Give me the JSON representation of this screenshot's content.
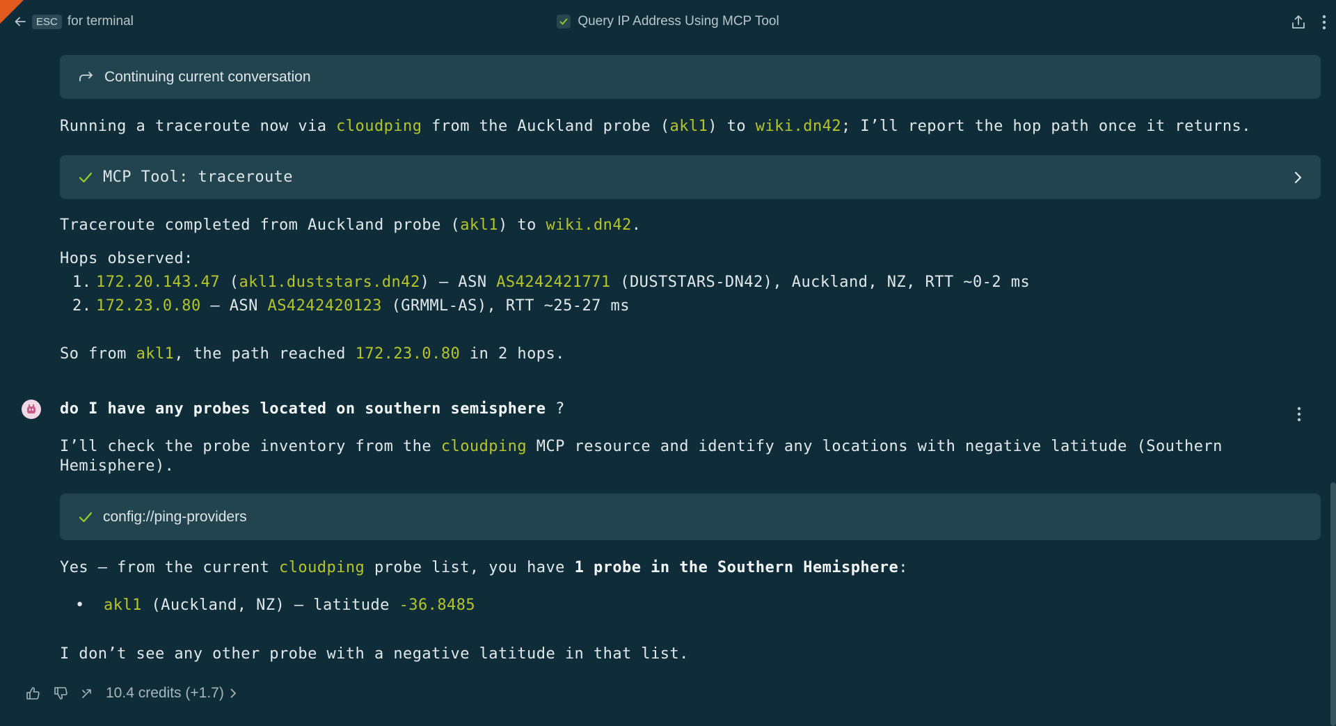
{
  "header": {
    "back_label": "for terminal",
    "esc_key": "ESC",
    "title": "Query IP Address Using MCP Tool"
  },
  "conversation": {
    "continuing_label": "Continuing current conversation",
    "msg1": {
      "t1": "Running a traceroute now via ",
      "t2": "cloudping",
      "t3": " from the Auckland probe (",
      "t4": "akl1",
      "t5": ") to ",
      "t6": "wiki.dn42",
      "t7": "; I’ll report the hop path once it returns."
    },
    "tool1_label": "MCP Tool: traceroute",
    "msg2": {
      "t1": "Traceroute completed from Auckland probe (",
      "t2": "akl1",
      "t3": ") to ",
      "t4": "wiki.dn42",
      "t5": "."
    },
    "hops": {
      "heading": "Hops observed:",
      "items": [
        {
          "num": "1.",
          "ip": "172.20.143.47",
          "a": " (",
          "host": "akl1.duststars.dn42",
          "b": ") — ASN ",
          "asn": "AS4242421771",
          "c": " (DUSTSTARS-DN42), Auckland, NZ, RTT ~0-2 ms"
        },
        {
          "num": "2.",
          "ip": "172.23.0.80",
          "b": " — ASN ",
          "asn": "AS4242420123",
          "c": " (GRMML-AS), RTT ~25-27 ms"
        }
      ]
    },
    "summary": {
      "t1": "So from ",
      "t2": "akl1",
      "t3": ", the path reached ",
      "t4": "172.23.0.80",
      "t5": " in 2 hops."
    },
    "user_msg": {
      "bold": "do I have any probes located on southern semisphere",
      "rest": " ?"
    },
    "msg3": {
      "t1": "I’ll check the probe inventory from the ",
      "t2": "cloudping",
      "t3": " MCP resource and identify any locations with negative latitude (Southern Hemisphere)."
    },
    "resource_label": "config://ping-providers",
    "msg4": {
      "t1": "Yes — from the current ",
      "t2": "cloudping",
      "t3": " probe list, you have ",
      "bold": "1 probe in the Southern Hemisphere",
      "t4": ":"
    },
    "bullet": {
      "mark": "•",
      "name": "akl1",
      "mid": " (Auckland, NZ) — latitude ",
      "lat": "-36.8485"
    },
    "final": "I don’t see any other probe with a negative latitude in that list."
  },
  "footer": {
    "credits": "10.4 credits (+1.7)"
  },
  "colors": {
    "background": "#0f2d38",
    "panel": "#22444f",
    "highlight": "#b6c42b",
    "check": "#9ccc2b",
    "accent_corner": "#e35a1f"
  }
}
